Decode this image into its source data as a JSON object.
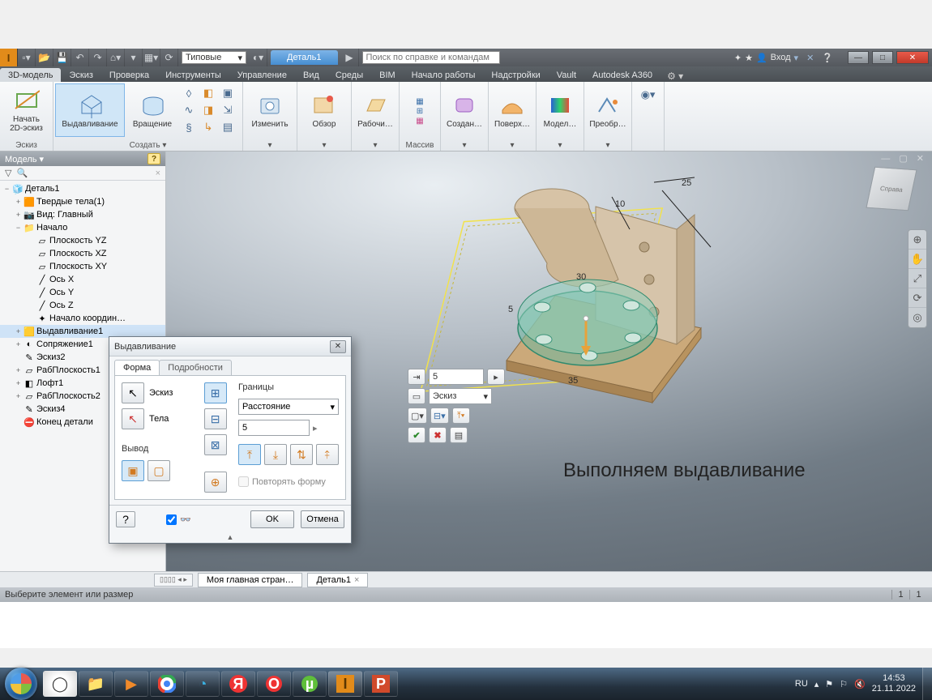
{
  "qat": {
    "style_combo": "Типовые",
    "doc_tab": "Деталь1",
    "search_placeholder": "Поиск по справке и командам",
    "login": "Вход"
  },
  "tabs": [
    "3D-модель",
    "Эскиз",
    "Проверка",
    "Инструменты",
    "Управление",
    "Вид",
    "Среды",
    "BIM",
    "Начало работы",
    "Надстройки",
    "Vault",
    "Autodesk A360"
  ],
  "active_tab_index": 0,
  "ribbon": {
    "panel_sketch": {
      "label": "Эскиз",
      "btn": "Начать\n2D-эскиз"
    },
    "panel_create": {
      "label": "Создать",
      "extrude": "Выдавливание",
      "revolve": "Вращение"
    },
    "panel_modify": "Изменить",
    "panel_inspect": "Обзор",
    "panel_workfeat": "Рабочи…",
    "panel_pattern": "Массив",
    "panel_freeform": "Создан…",
    "panel_surface": "Поверх…",
    "panel_sim": "Модел…",
    "panel_convert": "Преобр…"
  },
  "model_panel": {
    "title": "Модель ▾",
    "root": "Деталь1",
    "items": [
      {
        "t": "Твердые тела(1)",
        "ind": 1,
        "tw": "+",
        "ico": "🟧"
      },
      {
        "t": "Вид: Главный",
        "ind": 1,
        "tw": "+",
        "ico": "📷"
      },
      {
        "t": "Начало",
        "ind": 1,
        "tw": "−",
        "ico": "📁"
      },
      {
        "t": "Плоскость YZ",
        "ind": 2,
        "ico": "▱"
      },
      {
        "t": "Плоскость XZ",
        "ind": 2,
        "ico": "▱"
      },
      {
        "t": "Плоскость XY",
        "ind": 2,
        "ico": "▱"
      },
      {
        "t": "Ось X",
        "ind": 2,
        "ico": "╱"
      },
      {
        "t": "Ось Y",
        "ind": 2,
        "ico": "╱"
      },
      {
        "t": "Ось Z",
        "ind": 2,
        "ico": "╱"
      },
      {
        "t": "Начало координ…",
        "ind": 2,
        "ico": "✦"
      },
      {
        "t": "Выдавливание1",
        "ind": 1,
        "tw": "+",
        "ico": "🟨",
        "sel": true
      },
      {
        "t": "Сопряжение1",
        "ind": 1,
        "tw": "+",
        "ico": "◐"
      },
      {
        "t": "Эскиз2",
        "ind": 1,
        "ico": "✎"
      },
      {
        "t": "РабПлоскость1",
        "ind": 1,
        "tw": "+",
        "ico": "▱"
      },
      {
        "t": "Лофт1",
        "ind": 1,
        "tw": "+",
        "ico": "◧"
      },
      {
        "t": "РабПлоскость2",
        "ind": 1,
        "tw": "+",
        "ico": "▱"
      },
      {
        "t": "Эскиз4",
        "ind": 1,
        "ico": "✎"
      },
      {
        "t": "Конец детали",
        "ind": 1,
        "ico": "⛔"
      }
    ]
  },
  "dialog": {
    "title": "Выдавливание",
    "tab_shape": "Форма",
    "tab_more": "Подробности",
    "grp_output": "Вывод",
    "pick_profile": "Эскиз",
    "pick_solids": "Тела",
    "grp_extents": "Границы",
    "extents_combo": "Расстояние",
    "distance": "5",
    "match_shape": "Повторять форму",
    "ok": "OK",
    "cancel": "Отмена"
  },
  "mini": {
    "distance": "5",
    "profile_combo": "Эскиз"
  },
  "dims": {
    "d1": "10",
    "d2": "25",
    "d3": "5",
    "d4": "35",
    "d5": "30"
  },
  "caption": "Выполняем выдавливание",
  "doctabs": {
    "home": "Моя главная стран…",
    "part": "Деталь1"
  },
  "status": {
    "hint": "Выберите элемент или размер",
    "c1": "1",
    "c2": "1"
  },
  "viewcube": "Справа",
  "tray": {
    "lang": "RU",
    "time": "14:53",
    "date": "21.11.2022"
  }
}
